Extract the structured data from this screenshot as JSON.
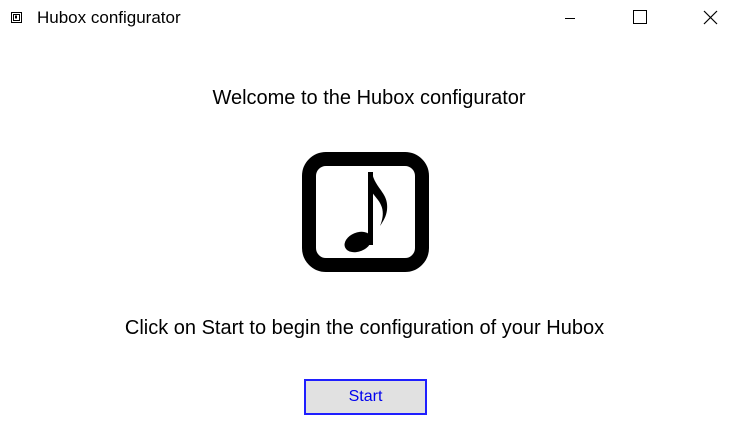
{
  "window": {
    "title": "Hubox configurator",
    "controls": {
      "minimize_icon": "minimize-icon",
      "maximize_icon": "maximize-icon",
      "close_icon": "close-icon"
    }
  },
  "main": {
    "welcome_text": "Welcome to the Hubox configurator",
    "logo_icon": "music-note-icon",
    "instruction_text": "Click on Start to begin the configuration of your Hubox",
    "start_label": "Start"
  },
  "colors": {
    "button_border": "#1f1fff",
    "button_background": "#e1e1e1",
    "button_text": "#0000ee"
  }
}
